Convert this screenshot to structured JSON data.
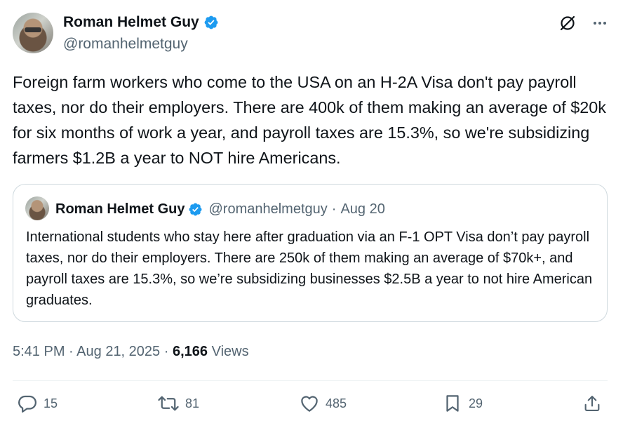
{
  "author": {
    "name": "Roman Helmet Guy",
    "handle": "@romanhelmetguy"
  },
  "tweet": {
    "text": "Foreign farm workers who come to the USA on an H-2A Visa don't pay payroll taxes, nor do their employers. There are 400k of them making an average of $20k for six months of work a year, and payroll taxes are 15.3%, so we're subsidizing farmers $1.2B a year to NOT hire Americans."
  },
  "quote": {
    "name": "Roman Helmet Guy",
    "handle": "@romanhelmetguy",
    "separator": "·",
    "date": "Aug 20",
    "text": "International students who stay here after graduation via an F-1 OPT Visa don’t pay payroll taxes, nor do their employers. There are 250k of them making an average of $70k+, and payroll taxes are 15.3%, so we’re subsidizing businesses $2.5B a year to not hire American graduates."
  },
  "meta": {
    "time": "5:41 PM",
    "sep1": "·",
    "date": "Aug 21, 2025",
    "sep2": "·",
    "views_count": "6,166",
    "views_label": "Views"
  },
  "actions": {
    "replies": "15",
    "reposts": "81",
    "likes": "485",
    "bookmarks": "29"
  },
  "colors": {
    "verified": "#1d9bf0",
    "secondary_text": "#536471",
    "primary_text": "#0f1419",
    "border": "#cfd9de"
  },
  "icons": {
    "verified": "verified-badge-icon",
    "grok": "grok-icon",
    "more": "more-icon",
    "reply": "reply-icon",
    "retweet": "retweet-icon",
    "like": "heart-icon",
    "bookmark": "bookmark-icon",
    "share": "share-icon"
  }
}
